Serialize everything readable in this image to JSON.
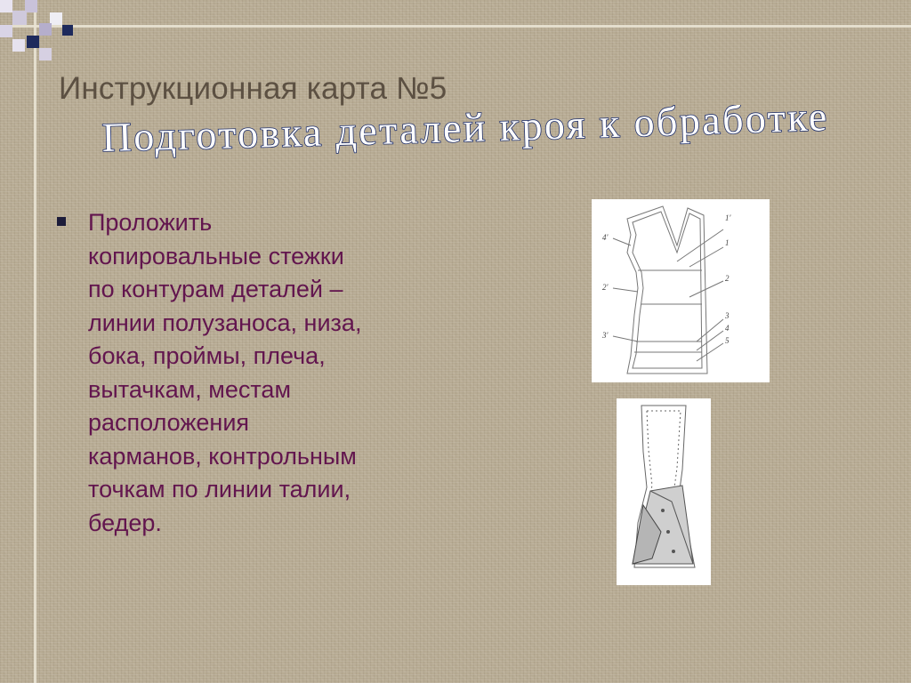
{
  "slide": {
    "title": "Инструкционная карта №5",
    "subtitle": "Подготовка деталей кроя к обработке",
    "bullet_text": "Проложить\nкопировальные стежки\nпо контурам деталей –\nлинии полузаноса, низа,\nбока, проймы, плеча,\nвытачкам, местам\nрасположения\nкарманов, контрольным\nточкам по линии талии,\nбедер."
  },
  "figure_bodice": {
    "left_labels": [
      "4'",
      "2'",
      "3'"
    ],
    "right_labels": [
      "1'",
      "1",
      "2",
      "3",
      "4",
      "5"
    ]
  },
  "colors": {
    "background": "#b7ab93",
    "title": "#5c5042",
    "subtitle_fill": "#ffffff",
    "subtitle_outline": "#1f2f6b",
    "bullet_text": "#62154e",
    "bullet_marker": "#1c1c3a",
    "deco_square_navy": "#1e2a5c",
    "deco_square_light": "#d9d4e6"
  }
}
